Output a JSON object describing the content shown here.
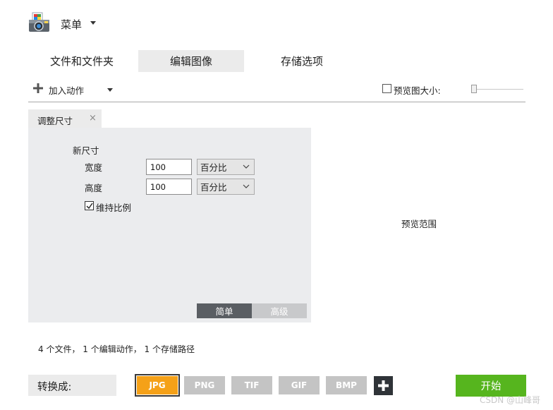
{
  "header": {
    "menu_label": "菜单",
    "logo_icon": "camera-photos-icon"
  },
  "tabs": [
    {
      "label": "文件和文件夹",
      "active": false
    },
    {
      "label": "编辑图像",
      "active": true
    },
    {
      "label": "存储选项",
      "active": false
    }
  ],
  "toolbar": {
    "add_action_label": "加入动作",
    "preview_size_label": "预览图大小:",
    "preview_size_checked": false,
    "preview_size_slider_value": 0
  },
  "action": {
    "tab_label": "调整尺寸",
    "close_glyph": "×",
    "section_title": "新尺寸",
    "width_label": "宽度",
    "width_value": "100",
    "width_unit": "百分比",
    "height_label": "高度",
    "height_value": "100",
    "height_unit": "百分比",
    "keep_ratio_label": "维持比例",
    "keep_ratio_checked": true,
    "mode_simple": "简单",
    "mode_advanced": "高级",
    "mode_selected": "简单"
  },
  "preview": {
    "label": "预览范围"
  },
  "summary": "4 个文件， 1 个编辑动作， 1 个存储路径",
  "footer": {
    "convert_label": "转换成:",
    "formats": [
      "JPG",
      "PNG",
      "TIF",
      "GIF",
      "BMP"
    ],
    "selected_format": "JPG",
    "start_label": "开始",
    "watermark": "CSDN @山峰哥"
  },
  "colors": {
    "accent_orange": "#f5a118",
    "start_green": "#56b51e",
    "panel_gray": "#ebecee",
    "dark_button": "#5a5e63"
  }
}
